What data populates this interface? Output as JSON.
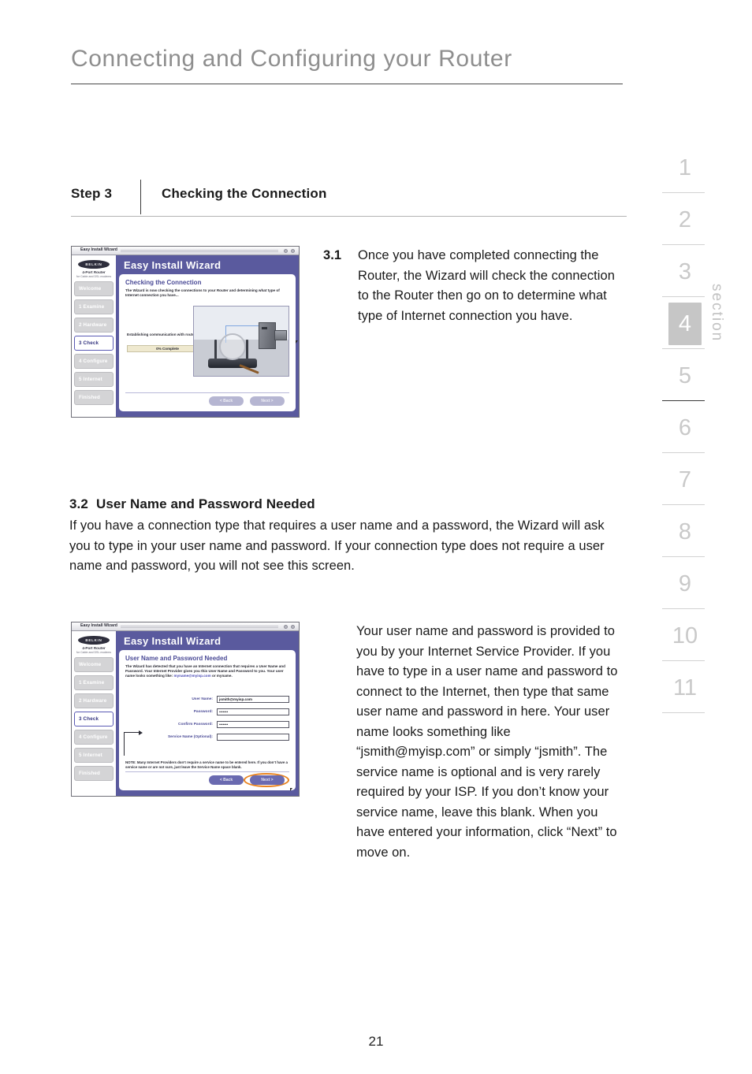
{
  "page": {
    "title": "Connecting and Configuring your Router",
    "number": "21"
  },
  "step_bar": {
    "step_label": "Step 3",
    "step_title": "Checking the Connection"
  },
  "item_3_1": {
    "number": "3.1",
    "text": "Once you have completed connecting the Router, the Wizard will check the connection to the Router then go on to determine what type of Internet connection you have."
  },
  "section_3_2": {
    "number": "3.2",
    "heading": "User Name and Password Needed",
    "paragraph": "If you have a connection type that requires a user name and a password, the Wizard will ask you to type in your user name and password. If your connection type does not require a user name and password, you will not see this screen.",
    "right_column": "Your user name and password is provided to you by your Internet Service Provider. If you have to type in a user name and password to connect to the Internet, then type that same user name and password in here. Your user name looks something like “jsmith@myisp.com” or simply “jsmith”. The service name is optional and is very rarely required by your ISP. If you don’t know your service name, leave this blank. When you have entered your information, click “Next” to move on."
  },
  "section_rail": {
    "word": "section",
    "active": "4",
    "tabs": [
      "1",
      "2",
      "3",
      "4",
      "5",
      "6",
      "7",
      "8",
      "9",
      "10",
      "11"
    ]
  },
  "screenshot_1": {
    "window_title": "Easy Install Wizard",
    "app_heading": "Easy Install Wizard",
    "panel_title": "Checking the Connection",
    "intro_text": "The Wizard is now checking the connections to your Router and determining what type of Internet connection you have...",
    "progress_label": "Establishing communication with router...",
    "progress_value": "0% Complete",
    "brand": "BELKIN",
    "product_line1": "4-Port Router",
    "product_line2": "for Cable and DSL modems",
    "nav_items": [
      "Welcome",
      "1 Examine",
      "2 Hardware",
      "3 Check",
      "4 Configure",
      "5 Internet",
      "Finished"
    ],
    "nav_active": "3 Check",
    "back_button": "< Back",
    "next_button": "Next >"
  },
  "screenshot_2": {
    "window_title": "Easy Install Wizard",
    "app_heading": "Easy Install Wizard",
    "panel_title": "User Name and Password Needed",
    "intro_text_a": "The Wizard has detected that you have an Internet connection that requires a User Name and Password. Your Internet Provider gives you this User Name and Password to you. Your user name looks something like:",
    "intro_link": "myname@myisp.com",
    "intro_text_b": "or myname.",
    "brand": "BELKIN",
    "product_line1": "4-Port Router",
    "product_line2": "for Cable and DSL modems",
    "nav_items": [
      "Welcome",
      "1 Examine",
      "2 Hardware",
      "3 Check",
      "4 Configure",
      "5 Internet",
      "Finished"
    ],
    "nav_active": "3 Check",
    "fields": [
      {
        "label": "User Name:",
        "value": "jsmith@myisp.com"
      },
      {
        "label": "Password:",
        "value": "•••••••"
      },
      {
        "label": "Confirm Password:",
        "value": "•••••••"
      },
      {
        "label": "Service Name (Optional):",
        "value": ""
      }
    ],
    "note": "NOTE: Many Internet Providers don’t require a service name to be entered here. If you don’t have a service name or are not sure, just leave the Service Name space blank.",
    "back_button": "< Back",
    "next_button": "Next >",
    "highlight_color": "#e8821e"
  }
}
